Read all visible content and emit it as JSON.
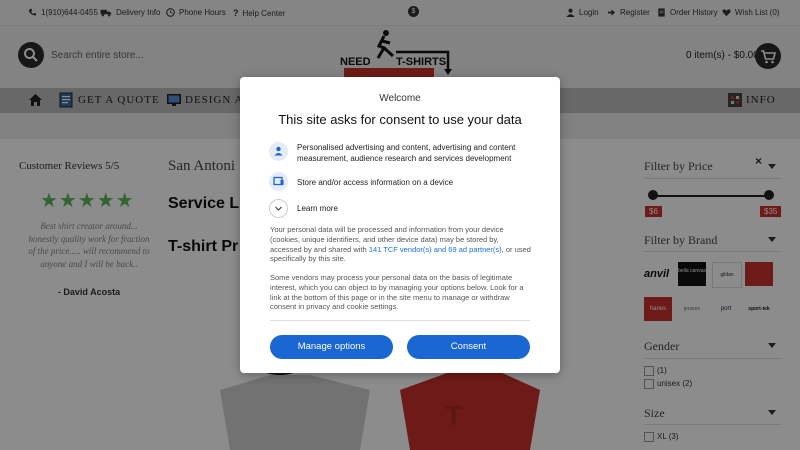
{
  "topbar": {
    "phone": "1(910)644-0455",
    "delivery": "Delivery Info",
    "hours": "Phone Hours",
    "help": "Help Center",
    "currency_symbol": "$",
    "login": "Login",
    "register": "Register",
    "order_history": "Order History",
    "wishlist": "Wish List (0)"
  },
  "header": {
    "search_placeholder": "Search entire store...",
    "logo_line1": "NEED",
    "logo_line2": "T-SHIRTS",
    "cart": "0 item(s) - $0.00"
  },
  "nav": {
    "get_quote": "GET A QUOTE",
    "design": "DESIGN A T",
    "info": "INFO"
  },
  "left": {
    "reviews_title": "Customer Reviews 5/5",
    "stars": "★★★★★",
    "review": "Best shirt creator around... honestly quality work for fraction of the price..... will recommend to anyone and I will be back..",
    "author": "- David Acosta"
  },
  "center": {
    "city": "San Antoni",
    "heading1": "Service L",
    "heading2": "T-shirt Pr"
  },
  "right": {
    "filter_price_title": "Filter by Price",
    "price_min": "$6",
    "price_max": "$35",
    "filter_brand_title": "Filter by Brand",
    "brands": [
      "anvil",
      "bella canvas",
      "gildan",
      "hanes",
      "jerzees",
      "port",
      "sport-tek"
    ],
    "gender_title": "Gender",
    "gender_options": [
      {
        "label": "(1)"
      },
      {
        "label": "unisex (2)"
      }
    ],
    "size_title": "Size",
    "size_options": [
      {
        "label": "XL (3)"
      }
    ]
  },
  "consent": {
    "welcome": "Welcome",
    "title": "This site asks for consent to use your data",
    "purpose1": "Personalised advertising and content, advertising and content measurement, audience research and services development",
    "purpose2": "Store and/or access information on a device",
    "learn_more": "Learn more",
    "para1_a": "Your personal data will be processed and information from your device (cookies, unique identifiers, and other device data) may be stored by, accessed by and shared with ",
    "para1_link": "141 TCF vendor(s) and 69 ad partner(s)",
    "para1_b": ", or used specifically by this site.",
    "para2": "Some vendors may process your personal data on the basis of legitimate interest, which you can object to by managing your options below. Look for a link at the bottom of this page or in the site menu to manage or withdraw consent in privacy and cookie settings.",
    "manage_button": "Manage options",
    "consent_button": "Consent"
  },
  "colors": {
    "accent": "#1a66d2",
    "star_green": "#5cb85c",
    "price_red": "#c9302c",
    "nav_gray": "#bdbdbd"
  }
}
